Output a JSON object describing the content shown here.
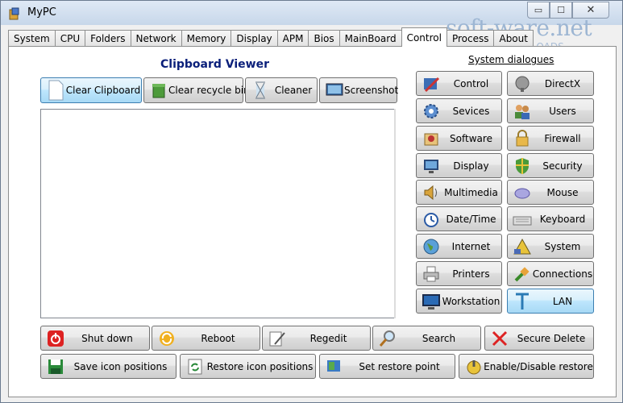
{
  "window": {
    "title": "MyPC"
  },
  "titlebar_buttons": {
    "minimize": "▭",
    "maximize": "☐",
    "close": "✕"
  },
  "tabs": [
    "System",
    "CPU",
    "Folders",
    "Network",
    "Memory",
    "Display",
    "APM",
    "Bios",
    "MainBoard",
    "Control",
    "Process",
    "About"
  ],
  "active_tab": "Control",
  "watermark": {
    "brand": "soft-ware.net",
    "tagline": "AKTUELLE DOWNLOADS"
  },
  "clipboard": {
    "heading": "Clipboard Viewer",
    "buttons": [
      "Clear Clipboard",
      "Clear recycle bin",
      "Cleaner",
      "Screenshot"
    ]
  },
  "system_dialogues": {
    "heading": "System dialogues",
    "buttons": [
      "Control",
      "DirectX",
      "Sevices",
      "Users",
      "Software",
      "Firewall",
      "Display",
      "Security",
      "Multimedia",
      "Mouse",
      "Date/Time",
      "Keyboard",
      "Internet",
      "System",
      "Printers",
      "Connections",
      "Workstation",
      "LAN"
    ]
  },
  "bottom_row1": [
    "Shut down",
    "Reboot",
    "Regedit",
    "Search",
    "Secure Delete"
  ],
  "bottom_row2": [
    "Save icon positions",
    "Restore icon positions",
    "Set restore point",
    "Enable/Disable restore"
  ],
  "colors": {
    "heading": "#0a1f7a",
    "accent": "#3c7fb1",
    "watermark": "#9db6d3"
  }
}
